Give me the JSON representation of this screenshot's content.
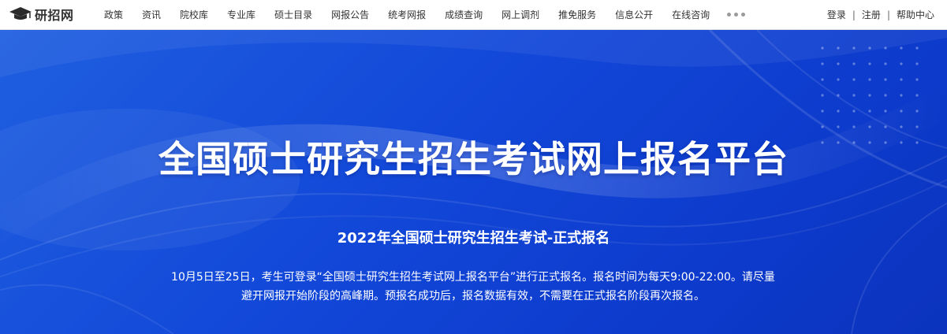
{
  "brand": {
    "name": "研招网",
    "icon": "graduation-cap-icon"
  },
  "nav": {
    "items": [
      "政策",
      "资讯",
      "院校库",
      "专业库",
      "硕士目录",
      "网报公告",
      "统考网报",
      "成绩查询",
      "网上调剂",
      "推免服务",
      "信息公开",
      "在线咨询"
    ],
    "more_icon": "more-dots-icon"
  },
  "account": {
    "login": "登录",
    "separator": "|",
    "register": "注册",
    "help": "帮助中心"
  },
  "hero": {
    "title": "全国硕士研究生招生考试网上报名平台",
    "subtitle": "2022年全国硕士研究生招生考试-正式报名",
    "description_line1": "10月5日至25日，考生可登录“全国硕士研究生招生考试网上报名平台”进行正式报名。报名时间为每天9:00-22:00。请尽量",
    "description_line2": "避开网报开始阶段的高峰期。预报名成功后，报名数据有效，不需要在正式报名阶段再次报名。"
  },
  "colors": {
    "hero_blue": "#1247d8",
    "text_dark": "#333333",
    "white": "#ffffff"
  }
}
